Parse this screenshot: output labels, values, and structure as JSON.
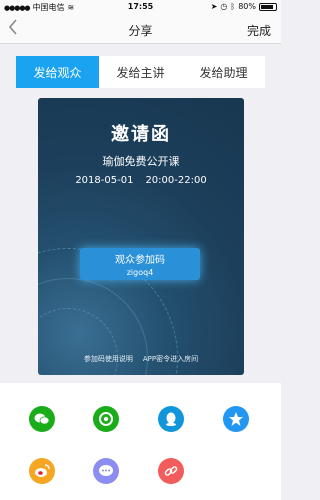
{
  "status_bar": {
    "carrier": "中国电信",
    "time": "17:55",
    "battery": "80%"
  },
  "nav": {
    "back_icon": "chevron-left-icon",
    "title": "分享",
    "done": "完成"
  },
  "tabs": [
    {
      "label": "发给观众",
      "active": true
    },
    {
      "label": "发给主讲",
      "active": false
    },
    {
      "label": "发给助理",
      "active": false
    }
  ],
  "card": {
    "title": "邀请函",
    "subtitle": "瑜伽免费公开课",
    "date": "2018-05-01",
    "time_range": "20:00-22:00",
    "code_label": "观众参加码",
    "code": "zigoq4",
    "link_help": "参加码使用说明",
    "link_app": "APP密令进入房间"
  },
  "share": [
    {
      "name": "wechat-icon",
      "color": "#1aad19"
    },
    {
      "name": "moments-icon",
      "color": "#1aad19"
    },
    {
      "name": "qq-icon",
      "color": "#1296db"
    },
    {
      "name": "qzone-icon",
      "color": "#2196f3"
    },
    {
      "name": "weibo-icon",
      "color": "#f5a623"
    },
    {
      "name": "sms-icon",
      "color": "#8b8ef0"
    },
    {
      "name": "copy-link-icon",
      "color": "#f25c5c"
    }
  ],
  "colors": {
    "accent": "#1aa3f0"
  }
}
